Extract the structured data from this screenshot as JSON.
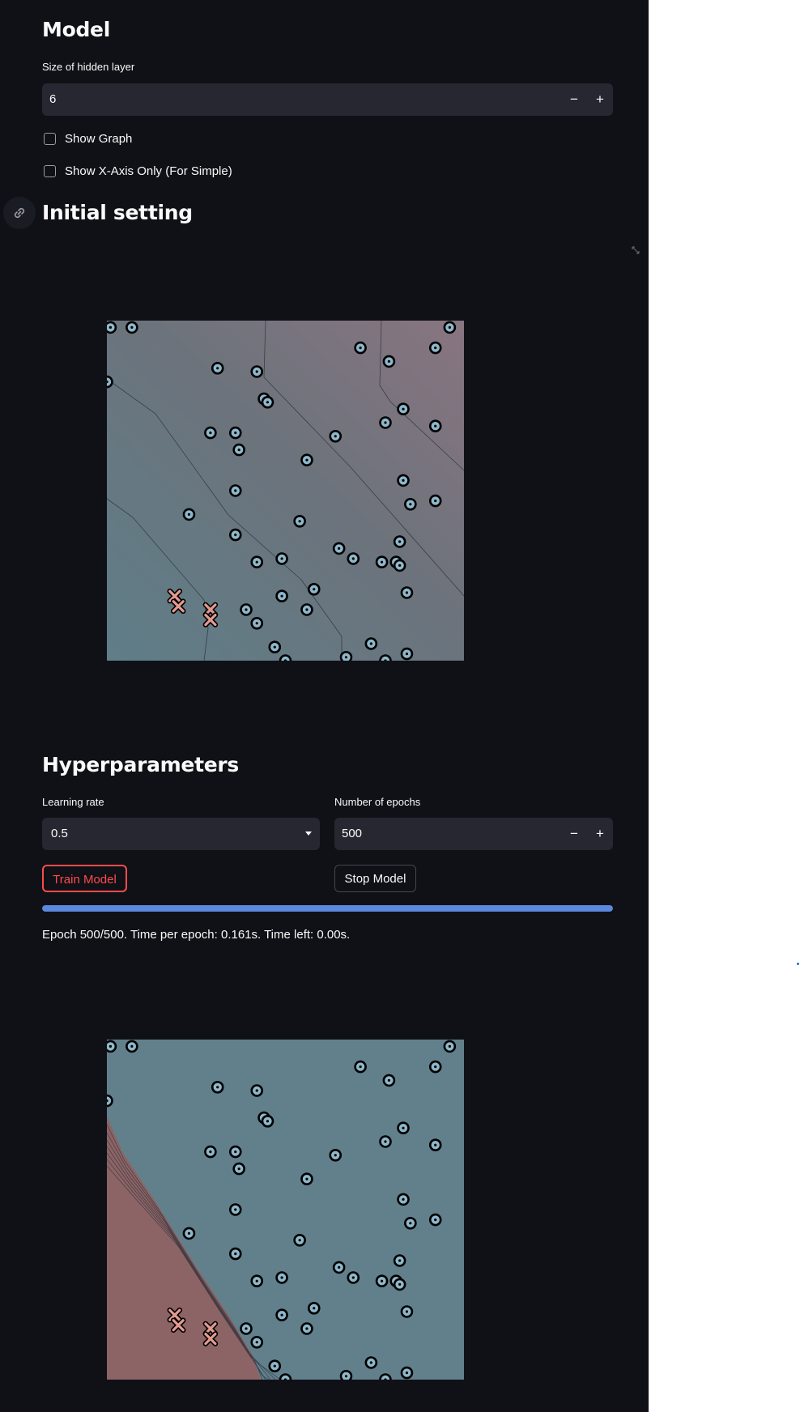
{
  "model": {
    "title": "Model",
    "hidden_layer_label": "Size of hidden layer",
    "hidden_layer_value": "6",
    "decrement_symbol": "−",
    "increment_symbol": "+",
    "show_graph_label": "Show Graph",
    "show_graph_checked": false,
    "show_x_axis_label": "Show X-Axis Only (For Simple)",
    "show_x_axis_checked": false
  },
  "initial": {
    "title": "Initial setting",
    "link_icon": "link-icon",
    "expand_icon": "expand-icon"
  },
  "hyper": {
    "title": "Hyperparameters",
    "lr_label": "Learning rate",
    "lr_value": "0.5",
    "epochs_label": "Number of epochs",
    "epochs_value": "500",
    "train_button": "Train Model",
    "stop_button": "Stop Model",
    "progress": 1.0,
    "status_text": "Epoch 500/500. Time per epoch: 0.161s. Time left: 0.00s."
  },
  "colors": {
    "app_bg": "#0f1117",
    "input_bg": "#262730",
    "progress": "#5a88de",
    "train_border": "#ff4b4b",
    "circle_fill": "#8fb7c9",
    "cross_fill": "#e59a8f",
    "initial_region": "#6c7680",
    "trained_blue_region": "#62808c",
    "trained_red_region": "#8c6466"
  },
  "chart_data": [
    {
      "type": "scatter",
      "name_hint": "initial decision boundary",
      "xlim": [
        0,
        1
      ],
      "ylim": [
        0,
        1
      ],
      "circles": [
        [
          0.01,
          0.98
        ],
        [
          0.07,
          0.98
        ],
        [
          0.96,
          0.98
        ],
        [
          0.71,
          0.92
        ],
        [
          0.92,
          0.92
        ],
        [
          0.79,
          0.88
        ],
        [
          0.31,
          0.86
        ],
        [
          0.42,
          0.85
        ],
        [
          0.0,
          0.82
        ],
        [
          0.44,
          0.77
        ],
        [
          0.45,
          0.76
        ],
        [
          0.83,
          0.74
        ],
        [
          0.78,
          0.7
        ],
        [
          0.92,
          0.69
        ],
        [
          0.29,
          0.67
        ],
        [
          0.36,
          0.67
        ],
        [
          0.64,
          0.66
        ],
        [
          0.37,
          0.62
        ],
        [
          0.56,
          0.59
        ],
        [
          0.83,
          0.53
        ],
        [
          0.85,
          0.46
        ],
        [
          0.92,
          0.47
        ],
        [
          0.36,
          0.5
        ],
        [
          0.23,
          0.43
        ],
        [
          0.54,
          0.41
        ],
        [
          0.36,
          0.37
        ],
        [
          0.82,
          0.35
        ],
        [
          0.65,
          0.33
        ],
        [
          0.49,
          0.3
        ],
        [
          0.42,
          0.29
        ],
        [
          0.69,
          0.3
        ],
        [
          0.77,
          0.29
        ],
        [
          0.81,
          0.29
        ],
        [
          0.82,
          0.28
        ],
        [
          0.58,
          0.21
        ],
        [
          0.49,
          0.19
        ],
        [
          0.84,
          0.2
        ],
        [
          0.39,
          0.15
        ],
        [
          0.56,
          0.15
        ],
        [
          0.42,
          0.11
        ],
        [
          0.74,
          0.05
        ],
        [
          0.47,
          0.04
        ],
        [
          0.84,
          0.02
        ],
        [
          0.5,
          0.0
        ],
        [
          0.67,
          0.01
        ],
        [
          0.78,
          0.0
        ]
      ],
      "crosses": [
        [
          0.19,
          0.19
        ],
        [
          0.2,
          0.16
        ],
        [
          0.29,
          0.15
        ],
        [
          0.29,
          0.12
        ]
      ]
    },
    {
      "type": "scatter",
      "name_hint": "trained decision boundary",
      "xlim": [
        0,
        1
      ],
      "ylim": [
        0,
        1
      ],
      "circles": [
        [
          0.01,
          0.98
        ],
        [
          0.07,
          0.98
        ],
        [
          0.96,
          0.98
        ],
        [
          0.71,
          0.92
        ],
        [
          0.92,
          0.92
        ],
        [
          0.79,
          0.88
        ],
        [
          0.31,
          0.86
        ],
        [
          0.42,
          0.85
        ],
        [
          0.0,
          0.82
        ],
        [
          0.44,
          0.77
        ],
        [
          0.45,
          0.76
        ],
        [
          0.83,
          0.74
        ],
        [
          0.78,
          0.7
        ],
        [
          0.92,
          0.69
        ],
        [
          0.29,
          0.67
        ],
        [
          0.36,
          0.67
        ],
        [
          0.64,
          0.66
        ],
        [
          0.37,
          0.62
        ],
        [
          0.56,
          0.59
        ],
        [
          0.83,
          0.53
        ],
        [
          0.85,
          0.46
        ],
        [
          0.92,
          0.47
        ],
        [
          0.36,
          0.5
        ],
        [
          0.23,
          0.43
        ],
        [
          0.54,
          0.41
        ],
        [
          0.36,
          0.37
        ],
        [
          0.82,
          0.35
        ],
        [
          0.65,
          0.33
        ],
        [
          0.49,
          0.3
        ],
        [
          0.42,
          0.29
        ],
        [
          0.69,
          0.3
        ],
        [
          0.77,
          0.29
        ],
        [
          0.81,
          0.29
        ],
        [
          0.82,
          0.28
        ],
        [
          0.58,
          0.21
        ],
        [
          0.49,
          0.19
        ],
        [
          0.84,
          0.2
        ],
        [
          0.39,
          0.15
        ],
        [
          0.56,
          0.15
        ],
        [
          0.42,
          0.11
        ],
        [
          0.74,
          0.05
        ],
        [
          0.47,
          0.04
        ],
        [
          0.84,
          0.02
        ],
        [
          0.5,
          0.0
        ],
        [
          0.67,
          0.01
        ],
        [
          0.78,
          0.0
        ]
      ],
      "crosses": [
        [
          0.19,
          0.19
        ],
        [
          0.2,
          0.16
        ],
        [
          0.29,
          0.15
        ],
        [
          0.29,
          0.12
        ]
      ]
    }
  ]
}
